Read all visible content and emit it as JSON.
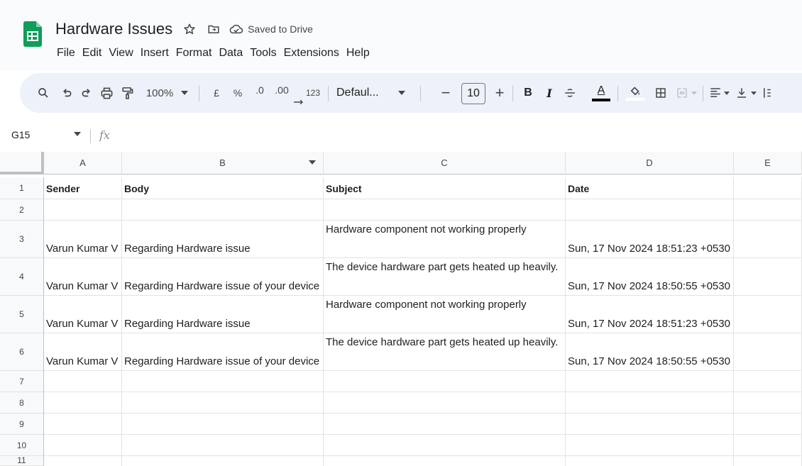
{
  "app": {
    "title": "Hardware Issues",
    "status": "Saved to Drive",
    "brand_color": "#0f9d58"
  },
  "menu": [
    "File",
    "Edit",
    "View",
    "Insert",
    "Format",
    "Data",
    "Tools",
    "Extensions",
    "Help"
  ],
  "toolbar": {
    "zoom": "100%",
    "currency": "£",
    "percent": "%",
    "decrease_decimal": ".0",
    "increase_decimal": ".00",
    "number_format": "123",
    "font": "Defaul...",
    "minus": "−",
    "font_size": "10",
    "plus": "+",
    "bold": "B",
    "italic": "I",
    "text_color_letter": "A",
    "icons": [
      "search-icon",
      "undo-icon",
      "redo-icon",
      "print-icon",
      "paint-format-icon",
      "strikethrough-icon",
      "fill-color-icon",
      "borders-icon",
      "merge-cells-icon",
      "align-left-icon",
      "valign-bottom-icon",
      "text-wrap-icon"
    ]
  },
  "formula_bar": {
    "cell_ref": "G15",
    "fx": "fx"
  },
  "columns": [
    "A",
    "B",
    "C",
    "D",
    "E"
  ],
  "rows": [
    "1",
    "2",
    "3",
    "4",
    "5",
    "6",
    "7",
    "8",
    "9",
    "10",
    "11"
  ],
  "sheet": {
    "headers": [
      "Sender",
      "Body",
      "Subject",
      "Date"
    ],
    "records": [
      {
        "sender": "Varun Kumar V",
        "body": "Regarding Hardware issue",
        "subject": "Hardware component not working properly",
        "date": "Sun, 17 Nov 2024 18:51:23 +0530"
      },
      {
        "sender": "Varun Kumar V",
        "body": "Regarding Hardware issue of your device",
        "subject": "The device hardware part gets heated up heavily.",
        "date": "Sun, 17 Nov 2024 18:50:55 +0530"
      },
      {
        "sender": "Varun Kumar V",
        "body": "Regarding Hardware issue",
        "subject": "Hardware component not working properly",
        "date": "Sun, 17 Nov 2024 18:51:23 +0530"
      },
      {
        "sender": "Varun Kumar V",
        "body": "Regarding Hardware issue of your device",
        "subject": "The device hardware part gets heated up heavily.",
        "date": "Sun, 17 Nov 2024 18:50:55 +0530"
      }
    ]
  }
}
